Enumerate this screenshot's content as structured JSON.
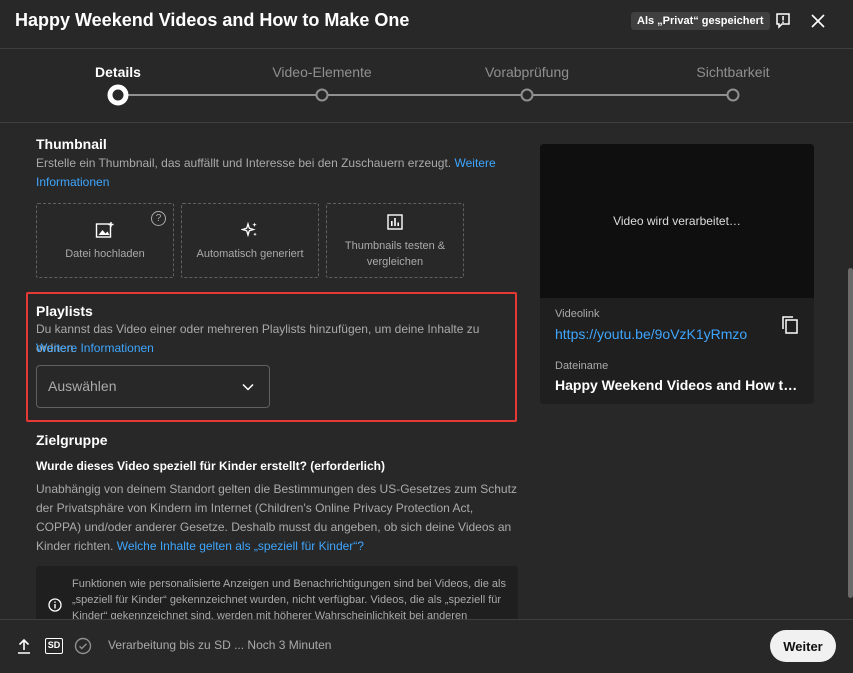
{
  "header": {
    "title": "Happy Weekend Videos and How to Make One",
    "saved_badge": "Als „Privat“ gespeichert"
  },
  "stepper": {
    "steps": [
      {
        "label": "Details",
        "active": true
      },
      {
        "label": "Video-Elemente",
        "active": false
      },
      {
        "label": "Vorabprüfung",
        "active": false
      },
      {
        "label": "Sichtbarkeit",
        "active": false
      }
    ]
  },
  "thumbnail": {
    "title": "Thumbnail",
    "description": "Erstelle ein Thumbnail, das auffällt und Interesse bei den Zuschauern erzeugt.",
    "link": "Weitere Informationen",
    "options": [
      {
        "label": "Datei hochladen",
        "icon": "image-upload-icon"
      },
      {
        "label": "Automatisch generiert",
        "icon": "sparkle-icon"
      },
      {
        "label": "Thumbnails testen & vergleichen",
        "icon": "bar-chart-icon"
      }
    ],
    "help_glyph": "?"
  },
  "playlists": {
    "title": "Playlists",
    "description": "Du kannst das Video einer oder mehreren Playlists hinzufügen, um deine Inhalte zu ordnen.",
    "link": "Weitere Informationen",
    "select_value": "Auswählen"
  },
  "audience": {
    "title": "Zielgruppe",
    "question": "Wurde dieses Video speziell für Kinder erstellt? (erforderlich)",
    "description": "Unabhängig von deinem Standort gelten die Bestimmungen des US-Gesetzes zum Schutz der Privatsphäre von Kindern im Internet (Children's Online Privacy Protection Act, COPPA) und/oder anderer Gesetze. Deshalb musst du angeben, ob sich deine Videos an Kinder richten.",
    "link": "Welche Inhalte gelten als „speziell für Kinder“?",
    "note": "Funktionen wie personalisierte Anzeigen und Benachrichtigungen sind bei Videos, die als „speziell für Kinder“ gekennzeichnet wurden, nicht verfügbar. Videos, die als „speziell für Kinder“ gekennzeichnet sind, werden mit höherer Wahrscheinlichkeit bei anderen"
  },
  "preview": {
    "processing_text": "Video wird verarbeitet…",
    "videolink_label": "Videolink",
    "videolink_url": "https://youtu.be/9oVzK1yRmzo",
    "filename_label": "Dateiname",
    "filename": "Happy Weekend Videos and How to Make One"
  },
  "footer": {
    "status_text": "Verarbeitung bis zu SD ... Noch 3 Minuten",
    "sd_badge": "SD",
    "next_label": "Weiter"
  },
  "colors": {
    "accent_link": "#3ea6ff",
    "highlight_border": "#e53935",
    "background": "#282828"
  }
}
